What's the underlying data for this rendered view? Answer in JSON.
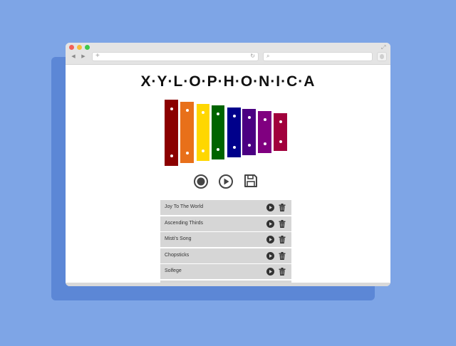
{
  "app": {
    "title": "X·Y·L·O·P·H·O·N·I·C·A"
  },
  "colors": {
    "background": "#7ea5e6",
    "bars": [
      "#8b0000",
      "#e8701a",
      "#ffd700",
      "#006400",
      "#00008b",
      "#4b0082",
      "#800080",
      "#a1003c"
    ]
  },
  "icons": {
    "record": "record-icon",
    "play": "play-icon",
    "save": "floppy-disk-icon",
    "song_play": "play-icon",
    "song_delete": "trash-icon"
  },
  "songs": [
    {
      "name": "Joy To The World"
    },
    {
      "name": "Ascending Thirds"
    },
    {
      "name": "Misti's Song"
    },
    {
      "name": "Chopsticks"
    },
    {
      "name": "Solfege"
    },
    {
      "name": ""
    }
  ]
}
